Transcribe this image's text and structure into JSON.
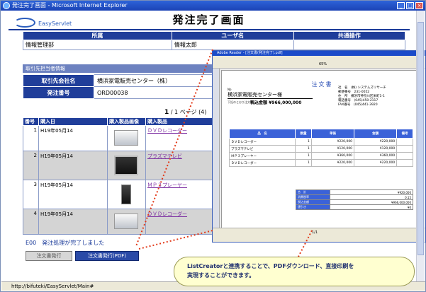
{
  "window": {
    "title": "発注完了画面 - Microsoft Internet Explorer"
  },
  "brand": {
    "logo_text": "EasyServlet"
  },
  "page": {
    "title": "発注完了画面"
  },
  "user_table": {
    "headers": [
      "所属",
      "ユーザ名",
      "共通操作"
    ],
    "values": [
      "情報管理部",
      "情報太郎",
      ""
    ]
  },
  "section": {
    "title": "取引先担当者情報"
  },
  "client": {
    "company_label": "取引先会社名",
    "company_value": "横浜家電販売センター（株）",
    "order_label": "発注番号",
    "order_value": "ORD00038"
  },
  "pager": {
    "current": "1",
    "text": "/ 1 ページ (4)"
  },
  "order_table": {
    "headers": [
      "番号",
      "購入日",
      "購入製品画像",
      "購入製品"
    ],
    "rows": [
      {
        "no": "1",
        "date": "H19年05月14",
        "product": "ＤＶＤレコーダー",
        "img": "dvd"
      },
      {
        "no": "2",
        "date": "H19年05月14",
        "product": "プラズマテレビ",
        "img": "tv"
      },
      {
        "no": "3",
        "date": "H19年05月14",
        "product": "ＭＰ３プレーヤー",
        "img": "mp3"
      },
      {
        "no": "4",
        "date": "H19年05月14",
        "product": "ＤＶＤレコーダー",
        "img": "dvd"
      }
    ]
  },
  "message": "E00　発注処理が完了しました",
  "buttons": {
    "issue": "注文書発行",
    "issue_pdf": "注文書発行(PDF)"
  },
  "status": {
    "url": "http://bifuteki/EasyServlet/Main#"
  },
  "pdf_window": {
    "title": "Adobe Reader - [注文書(発注完了).pdf]",
    "zoom": "65%",
    "page_indicator": "1/1"
  },
  "invoice": {
    "title": "注文書",
    "no_label": "No",
    "recipient": "横浜家電販売センター様",
    "note": "下記のとおり注文致します",
    "total": "税込金額 ¥966,000,000",
    "company_lines": [
      "社　名　(株) システムズリサーチ",
      "郵便番号　231-0052",
      "住　所　横浜市神奈川区栄町1-1",
      "電話番号　(045)450-2117",
      "FAX番号　(045)441-3920"
    ],
    "headers": [
      "品　名",
      "数量",
      "単価",
      "金額",
      "備考"
    ],
    "rows": [
      {
        "name": "ＤＶＤレコーダー",
        "qty": "1",
        "unit": "¥220,000",
        "amount": "¥220,000"
      },
      {
        "name": "プラズマテレビ",
        "qty": "1",
        "unit": "¥120,000",
        "amount": "¥120,000"
      },
      {
        "name": "ＭＰ３プレーヤー",
        "qty": "1",
        "unit": "¥360,000",
        "amount": "¥360,000"
      },
      {
        "name": "ＤＶＤレコーダー",
        "qty": "1",
        "unit": "¥220,000",
        "amount": "¥220,000"
      }
    ],
    "sums": [
      {
        "label": "合　計",
        "value": "¥920,000"
      },
      {
        "label": "消費税率",
        "value": "0.15"
      },
      {
        "label": "税込金額",
        "value": "¥966,000,000"
      },
      {
        "label": "値引き",
        "value": "¥0"
      }
    ]
  },
  "callout": {
    "line1": "ListCreatorと連携することで、PDFダウンロード、直接印刷を",
    "line2": "実現することができます。"
  }
}
